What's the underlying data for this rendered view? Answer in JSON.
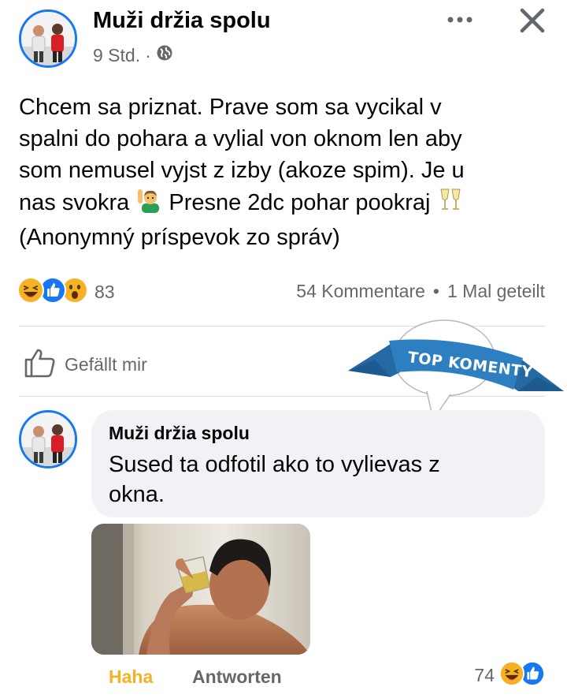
{
  "post": {
    "page_name": "Muži držia spolu",
    "time": "9 Std.",
    "separator": "·",
    "text_lines": [
      "Chcem sa priznat. Prave som sa vycikal v",
      "spalni do pohara a vylial von oknom len aby",
      "som nemusel vyjst z izby (akoze spim). Je u"
    ],
    "line4_a": "nas svokra",
    "line4_b": "Presne 2dc pohar pookraj",
    "line5": "(Anonymný príspevok zo správ)",
    "reactions_count": "83",
    "comments_count": "54 Kommentare",
    "dot": "•",
    "shares": "1 Mal geteilt",
    "like_label": "Gefällt mir"
  },
  "badge": {
    "label": "TOP KOMENTY"
  },
  "comment": {
    "author": "Muži držia spolu",
    "text_line1": "Sused ta odfotil ako to vylievas z",
    "text_line2": "okna.",
    "action_haha": "Haha",
    "action_reply": "Antworten",
    "reactions_count": "74"
  },
  "colors": {
    "facebook_blue": "#1877f2",
    "haha_yellow": "#f7b125",
    "secondary_text": "#65676b",
    "ribbon_blue": "#2d7fc1"
  },
  "icons": [
    "more-options-icon",
    "close-icon",
    "globe-icon",
    "raising-hand-emoji",
    "champagne-glasses-emoji",
    "haha-reaction-icon",
    "like-reaction-icon",
    "wow-reaction-icon",
    "thumbs-up-icon"
  ]
}
